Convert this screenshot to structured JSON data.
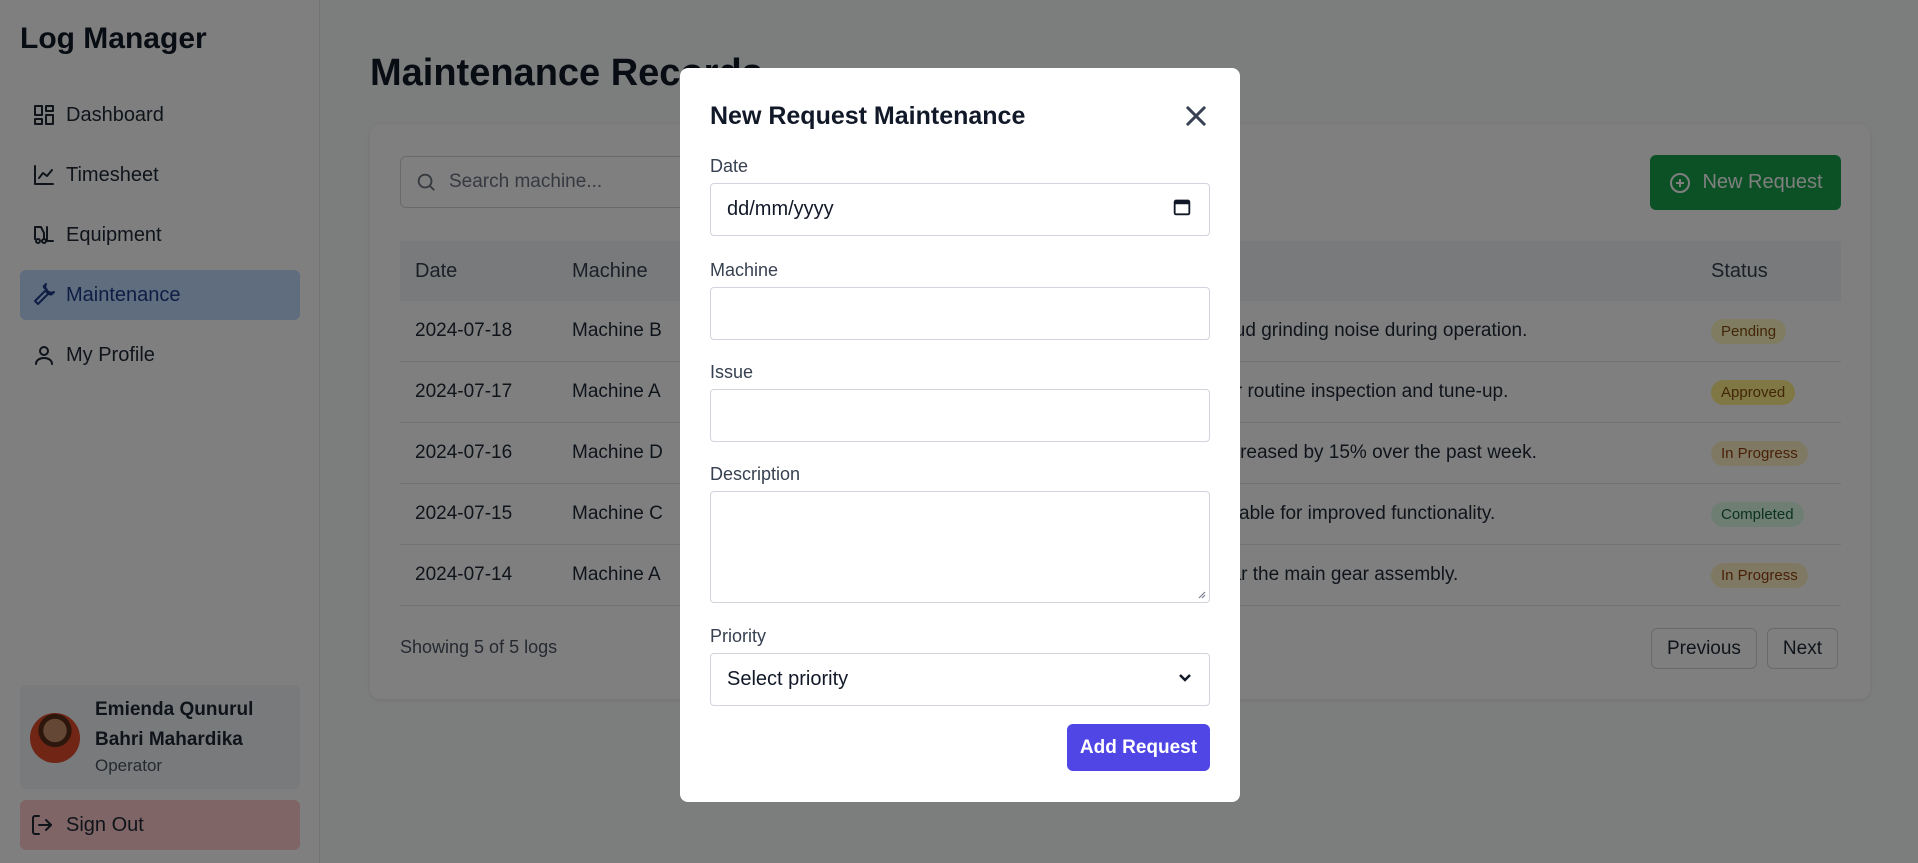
{
  "app": {
    "title": "Log Manager"
  },
  "sidebar": {
    "items": [
      {
        "label": "Dashboard",
        "icon": "dashboard-icon"
      },
      {
        "label": "Timesheet",
        "icon": "chart-line-icon"
      },
      {
        "label": "Equipment",
        "icon": "forklift-icon"
      },
      {
        "label": "Maintenance",
        "icon": "wrench-icon",
        "active": true
      },
      {
        "label": "My Profile",
        "icon": "user-icon"
      }
    ],
    "user": {
      "name_line1": "Emienda Qunurul",
      "name_line2": "Bahri Mahardika",
      "role": "Operator"
    },
    "signout_label": "Sign Out"
  },
  "main": {
    "page_title": "Maintenance Records",
    "search_placeholder": "Search machine...",
    "new_request_label": "New Request",
    "table": {
      "headers": {
        "date": "Date",
        "machine": "Machine",
        "status": "Status"
      },
      "rows": [
        {
          "date": "2024-07-18",
          "machine": "Machine B",
          "desc": "loud grinding noise during operation.",
          "status": "Pending"
        },
        {
          "date": "2024-07-17",
          "machine": "Machine A",
          "desc": "for routine inspection and tune-up.",
          "status": "Approved"
        },
        {
          "date": "2024-07-16",
          "machine": "Machine D",
          "desc": "ecreased by 15% over the past week.",
          "status": "In Progress"
        },
        {
          "date": "2024-07-15",
          "machine": "Machine C",
          "desc": "ailable for improved functionality.",
          "status": "Completed"
        },
        {
          "date": "2024-07-14",
          "machine": "Machine A",
          "desc": "ear the main gear assembly.",
          "status": "In Progress"
        }
      ]
    },
    "showing": "Showing 5 of 5 logs",
    "previous_label": "Previous",
    "next_label": "Next"
  },
  "modal": {
    "title": "New Request Maintenance",
    "date_label": "Date",
    "date_placeholder": "dd/mm/yyyy",
    "machine_label": "Machine",
    "issue_label": "Issue",
    "description_label": "Description",
    "priority_label": "Priority",
    "priority_value": "Select priority",
    "submit_label": "Add Request"
  },
  "colors": {
    "accent": "#4f46e5",
    "new_request": "#16a34a",
    "active_nav": "#bfdbfe",
    "signout": "#fecaca"
  }
}
